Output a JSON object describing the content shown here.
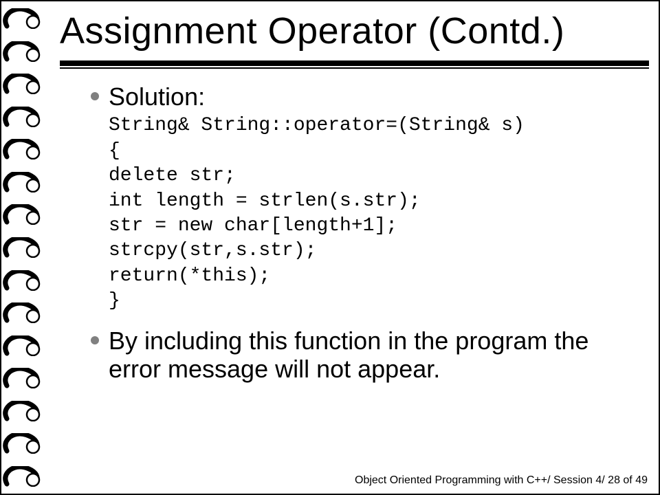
{
  "slide": {
    "title": "Assignment Operator (Contd.)",
    "bullets": [
      {
        "label": "Solution:"
      },
      {
        "label": "By including this function in the program the error message will not appear."
      }
    ],
    "code": [
      "String& String::operator=(String& s)",
      "{",
      "delete str;",
      "int length = strlen(s.str);",
      "str = new char[length+1];",
      "strcpy(str,s.str);",
      "return(*this);",
      "}"
    ],
    "footer": "Object Oriented Programming with C++/ Session 4/ 28 of 49"
  }
}
